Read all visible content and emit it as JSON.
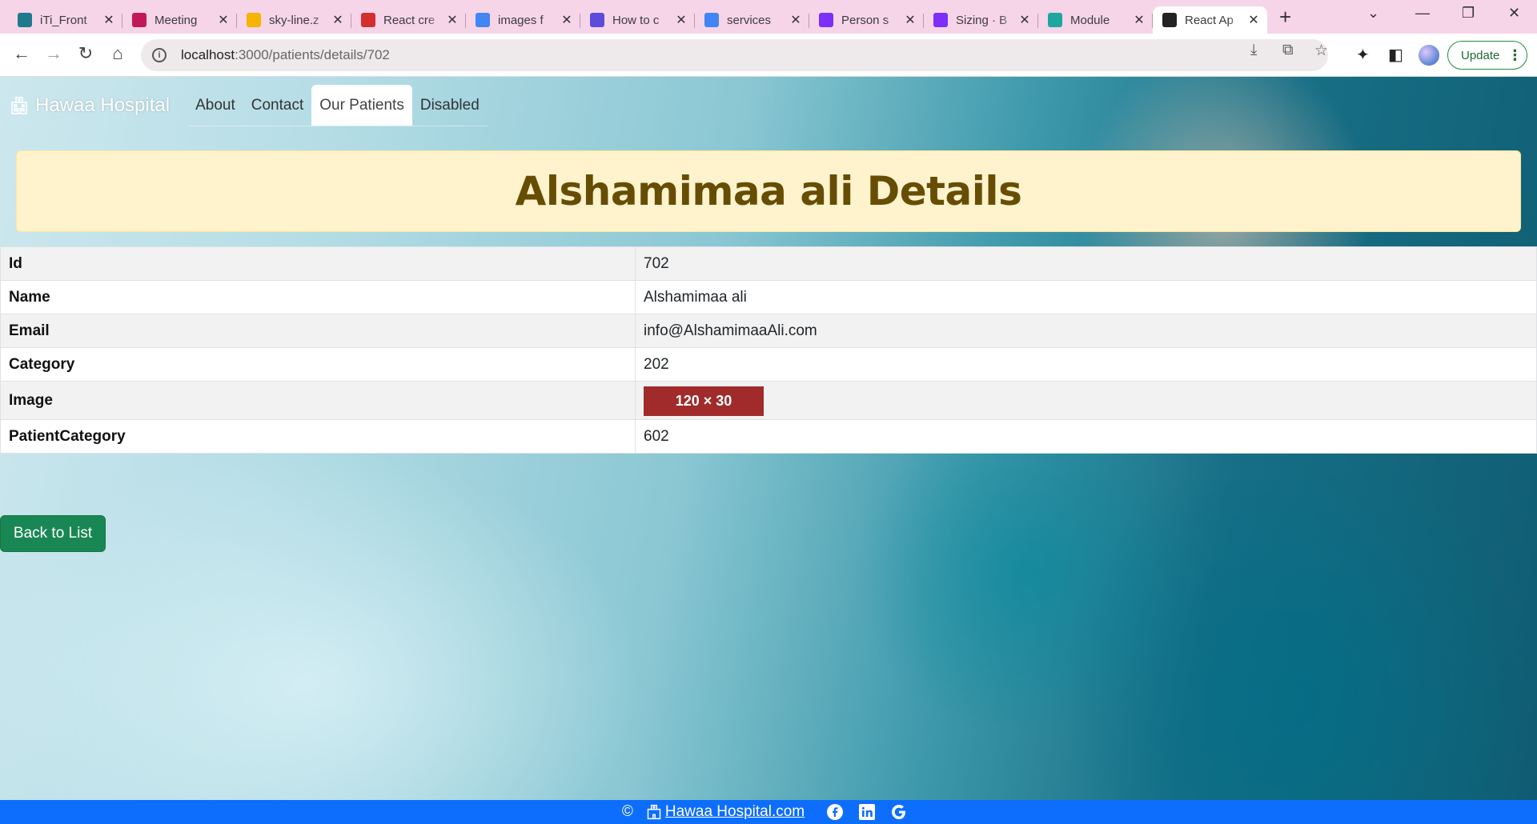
{
  "browser": {
    "tabs": [
      {
        "title": "iTi_Front",
        "favicon_color": "#1f7a8c",
        "icon": "sharepoint-icon"
      },
      {
        "title": "Meeting",
        "favicon_color": "#c2185b",
        "icon": "play-icon"
      },
      {
        "title": "sky-line.z",
        "favicon_color": "#f4b400",
        "icon": "drive-icon"
      },
      {
        "title": "React cre",
        "favicon_color": "#d32f2f",
        "icon": "vercel-icon"
      },
      {
        "title": "images f",
        "favicon_color": "#4285f4",
        "icon": "google-icon"
      },
      {
        "title": "How to c",
        "favicon_color": "#5b4cdb",
        "icon": "terminal-icon"
      },
      {
        "title": "services",
        "favicon_color": "#4285f4",
        "icon": "google-icon"
      },
      {
        "title": "Person s",
        "favicon_color": "#7b2ff7",
        "icon": "bootstrap-icon"
      },
      {
        "title": "Sizing · B",
        "favicon_color": "#7b2ff7",
        "icon": "bootstrap-icon"
      },
      {
        "title": "Module",
        "favicon_color": "#1ea7a0",
        "icon": "query-icon"
      },
      {
        "title": "React Ap",
        "favicon_color": "#222222",
        "icon": "react-icon"
      }
    ],
    "url_host": "localhost",
    "url_rest": ":3000/patients/details/702",
    "update_label": "Update"
  },
  "site": {
    "brand": "Hawaa Hospital",
    "nav": [
      "About",
      "Contact",
      "Our Patients",
      "Disabled"
    ],
    "active_nav": "Our Patients"
  },
  "heading": "Alshamimaa ali Details",
  "details": [
    {
      "key": "Id",
      "value": "702"
    },
    {
      "key": "Name",
      "value": "Alshamimaa ali"
    },
    {
      "key": "Email",
      "value": "info@AlshamimaaAli.com"
    },
    {
      "key": "Category",
      "value": "202"
    },
    {
      "key": "Image",
      "value": "120 × 30"
    },
    {
      "key": "PatientCategory",
      "value": "602"
    }
  ],
  "back_button": "Back to List",
  "footer": {
    "copyright": "©",
    "link": "Hawaa Hospital.com"
  },
  "colors": {
    "tabbar": "#f6d5e9",
    "heading_bg": "#fff3cd",
    "heading_text": "#664d03",
    "back_button": "#198754",
    "footer": "#0d6efd",
    "image_placeholder": "#a12b2b"
  }
}
